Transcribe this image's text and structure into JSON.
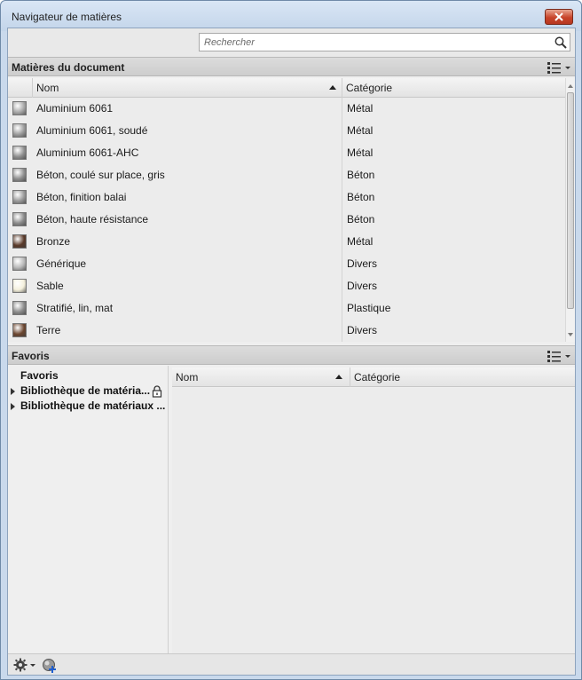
{
  "window": {
    "title": "Navigateur de matières"
  },
  "search": {
    "placeholder": "Rechercher"
  },
  "document_section": {
    "title": "Matières du document",
    "columns": {
      "name": "Nom",
      "category": "Catégorie"
    },
    "rows": [
      {
        "name": "Aluminium 6061",
        "category": "Métal",
        "swatch": "#a8a8a8"
      },
      {
        "name": "Aluminium 6061, soudé",
        "category": "Métal",
        "swatch": "#9c9c9c"
      },
      {
        "name": "Aluminium 6061-AHC",
        "category": "Métal",
        "swatch": "#8f8f8f"
      },
      {
        "name": "Béton, coulé sur place, gris",
        "category": "Béton",
        "swatch": "#8e8e8e"
      },
      {
        "name": "Béton, finition balai",
        "category": "Béton",
        "swatch": "#9a9a9a"
      },
      {
        "name": "Béton, haute résistance",
        "category": "Béton",
        "swatch": "#8a8a8a"
      },
      {
        "name": "Bronze",
        "category": "Métal",
        "swatch": "#5a3a2a"
      },
      {
        "name": "Générique",
        "category": "Divers",
        "swatch": "#b9b9b9"
      },
      {
        "name": "Sable",
        "category": "Divers",
        "swatch": "#f4f0dc"
      },
      {
        "name": "Stratifié, lin, mat",
        "category": "Plastique",
        "swatch": "#8c8c8c"
      },
      {
        "name": "Terre",
        "category": "Divers",
        "swatch": "#6b4630"
      }
    ]
  },
  "favorites_section": {
    "title": "Favoris",
    "tree": [
      {
        "label": "Favoris",
        "expandable": false,
        "locked": false
      },
      {
        "label": "Bibliothèque de matéria...",
        "expandable": true,
        "locked": true
      },
      {
        "label": "Bibliothèque de matériaux ...",
        "expandable": true,
        "locked": false
      }
    ],
    "columns": {
      "name": "Nom",
      "category": "Catégorie"
    }
  },
  "icons": {
    "close": "close-icon",
    "search": "search-icon",
    "view": "list-view-icon",
    "lock": "lock-icon",
    "settings": "gear-icon",
    "add": "add-material-icon"
  }
}
